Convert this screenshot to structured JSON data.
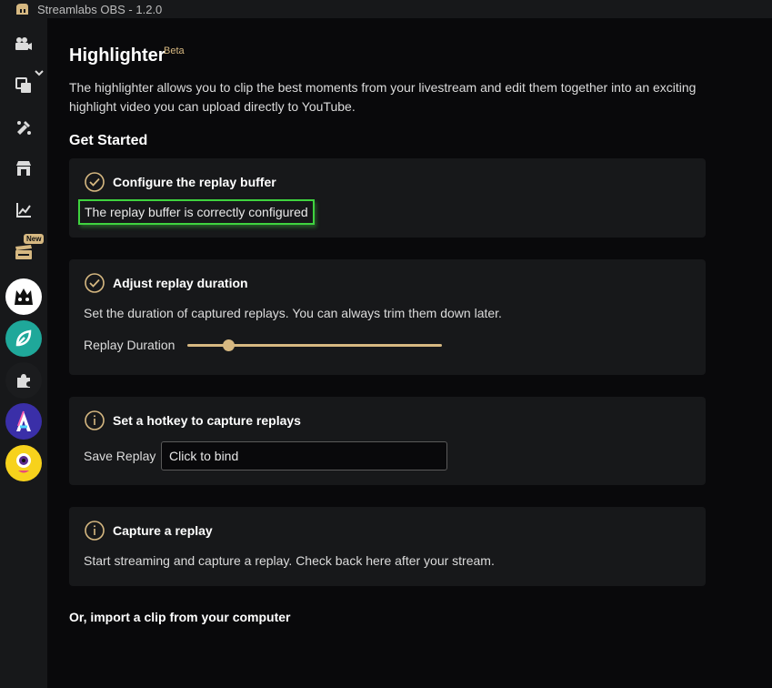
{
  "window": {
    "title": "Streamlabs OBS - 1.2.0"
  },
  "sidebar": {
    "items": [
      {
        "icon": "studio-camera-icon"
      },
      {
        "icon": "layers-icon"
      },
      {
        "icon": "themes-icon"
      },
      {
        "icon": "store-icon"
      },
      {
        "icon": "analytics-icon"
      },
      {
        "icon": "highlighter-icon",
        "badge": "New"
      }
    ],
    "apps": [
      {
        "icon": "monstercat-icon",
        "color": "#ffffff"
      },
      {
        "icon": "leaf-app-icon",
        "color": "#1fa89a"
      },
      {
        "icon": "puzzle-app-icon",
        "color": "#1b1c1e"
      },
      {
        "icon": "a-app-icon",
        "color": "#3a2fa8"
      },
      {
        "icon": "cyclops-app-icon",
        "color": "#f7d21c"
      }
    ]
  },
  "page": {
    "title": "Highlighter",
    "beta": "Beta",
    "description": "The highlighter allows you to clip the best moments from your livestream and edit them together into an exciting highlight video you can upload directly to YouTube.",
    "get_started": "Get Started",
    "import_link": "Or, import a clip from your computer"
  },
  "steps": {
    "replay_buffer": {
      "title": "Configure the replay buffer",
      "status": "The replay buffer is correctly configured",
      "state": "done"
    },
    "duration": {
      "title": "Adjust replay duration",
      "text": "Set the duration of captured replays. You can always trim them down later.",
      "slider_label": "Replay Duration",
      "slider_value": 0.16,
      "state": "done"
    },
    "hotkey": {
      "title": "Set a hotkey to capture replays",
      "label": "Save Replay",
      "placeholder": "Click to bind",
      "state": "todo"
    },
    "capture": {
      "title": "Capture a replay",
      "text": "Start streaming and capture a replay. Check back here after your stream.",
      "state": "todo"
    }
  },
  "colors": {
    "accent": "#d6b881",
    "highlight": "#3fd33f",
    "card": "#17181a",
    "bg": "#09090b"
  }
}
